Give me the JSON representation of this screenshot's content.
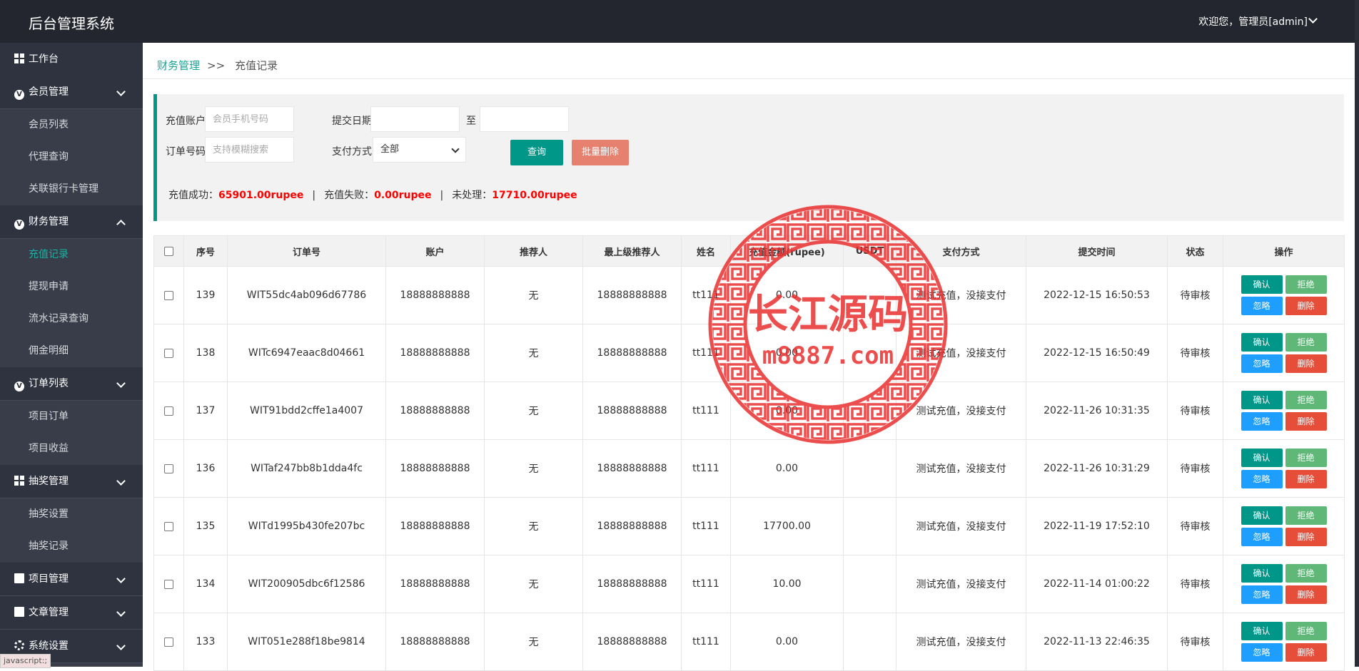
{
  "header": {
    "app_title": "后台管理系统",
    "user_text": "欢迎您，管理员[admin]"
  },
  "sidebar": {
    "items": [
      {
        "label": "工作台",
        "icon": "dashboard-icon",
        "type": "top"
      },
      {
        "label": "会员管理",
        "icon": "circle-v-icon",
        "type": "group",
        "expanded": true,
        "children": [
          "会员列表",
          "代理查询",
          "关联银行卡管理"
        ]
      },
      {
        "label": "财务管理",
        "icon": "circle-v-icon",
        "type": "group",
        "expanded": true,
        "children": [
          "充值记录",
          "提现申请",
          "流水记录查询",
          "佣金明细"
        ]
      },
      {
        "label": "订单列表",
        "icon": "circle-v-icon",
        "type": "group",
        "expanded": true,
        "children": [
          "项目订单",
          "项目收益"
        ]
      },
      {
        "label": "抽奖管理",
        "icon": "grid-icon",
        "type": "group",
        "expanded": true,
        "children": [
          "抽奖设置",
          "抽奖记录"
        ]
      },
      {
        "label": "项目管理",
        "icon": "doc-icon",
        "type": "group",
        "expanded": false,
        "children": []
      },
      {
        "label": "文章管理",
        "icon": "file-icon",
        "type": "group",
        "expanded": false,
        "children": []
      },
      {
        "label": "系统设置",
        "icon": "gear-icon",
        "type": "group",
        "expanded": false,
        "children": []
      }
    ],
    "active_sub": "充值记录"
  },
  "status_tip": "javascript:;",
  "breadcrumb": {
    "parent": "财务管理",
    "sep": ">>",
    "current": "充值记录"
  },
  "filters": {
    "account_label": "充值账户",
    "account_placeholder": "会员手机号码",
    "date_label": "提交日期",
    "date_to": "至",
    "order_label": "订单号码",
    "order_placeholder": "支持模糊搜索",
    "pay_label": "支付方式",
    "pay_value": "全部",
    "query_btn": "查询",
    "batch_delete_btn": "批量删除"
  },
  "stats": {
    "success_label": "充值成功：",
    "success_value": "65901.00rupee",
    "fail_label": "充值失败：",
    "fail_value": "0.00rupee",
    "pending_label": "未处理：",
    "pending_value": "17710.00rupee",
    "pipe": "|"
  },
  "table": {
    "columns": [
      "序号",
      "订单号",
      "账户",
      "推荐人",
      "最上级推荐人",
      "姓名",
      "充值金额(rupee)",
      "USDT",
      "支付方式",
      "提交时间",
      "状态",
      "操作"
    ],
    "rows": [
      {
        "id": "139",
        "order": "WIT55dc4ab096d67786",
        "account": "18888888888",
        "referrer": "无",
        "top_referrer": "18888888888",
        "name": "tt111",
        "amount": "0.00",
        "usdt": "",
        "pay": "测试充值，没接支付",
        "time": "2022-12-15 16:50:53",
        "status": "待审核"
      },
      {
        "id": "138",
        "order": "WITc6947eaac8d04661",
        "account": "18888888888",
        "referrer": "无",
        "top_referrer": "18888888888",
        "name": "tt111",
        "amount": "0.00",
        "usdt": "",
        "pay": "测试充值，没接支付",
        "time": "2022-12-15 16:50:49",
        "status": "待审核"
      },
      {
        "id": "137",
        "order": "WIT91bdd2cffe1a4007",
        "account": "18888888888",
        "referrer": "无",
        "top_referrer": "18888888888",
        "name": "tt111",
        "amount": "0.00",
        "usdt": "",
        "pay": "测试充值，没接支付",
        "time": "2022-11-26 10:31:35",
        "status": "待审核"
      },
      {
        "id": "136",
        "order": "WITaf247bb8b1dda4fc",
        "account": "18888888888",
        "referrer": "无",
        "top_referrer": "18888888888",
        "name": "tt111",
        "amount": "0.00",
        "usdt": "",
        "pay": "测试充值，没接支付",
        "time": "2022-11-26 10:31:29",
        "status": "待审核"
      },
      {
        "id": "135",
        "order": "WITd1995b430fe207bc",
        "account": "18888888888",
        "referrer": "无",
        "top_referrer": "18888888888",
        "name": "tt111",
        "amount": "17700.00",
        "usdt": "",
        "pay": "测试充值，没接支付",
        "time": "2022-11-19 17:52:10",
        "status": "待审核"
      },
      {
        "id": "134",
        "order": "WIT200905dbc6f12586",
        "account": "18888888888",
        "referrer": "无",
        "top_referrer": "18888888888",
        "name": "tt111",
        "amount": "10.00",
        "usdt": "",
        "pay": "测试充值，没接支付",
        "time": "2022-11-14 01:00:22",
        "status": "待审核"
      },
      {
        "id": "133",
        "order": "WIT051e288f18be9814",
        "account": "18888888888",
        "referrer": "无",
        "top_referrer": "18888888888",
        "name": "tt111",
        "amount": "0.00",
        "usdt": "",
        "pay": "测试充值，没接支付",
        "time": "2022-11-13 22:46:35",
        "status": "待审核"
      }
    ],
    "actions": {
      "confirm": "确认",
      "reject": "拒绝",
      "ignore": "忽略",
      "delete": "删除"
    }
  },
  "watermark": {
    "line1": "长江源码",
    "line2": "m8887.com",
    "color": "#e8302f"
  },
  "colors": {
    "accent": "#009688",
    "header_bg": "#23262e",
    "sidebar_bg": "#393d49",
    "stat_value": "#ff0000"
  }
}
